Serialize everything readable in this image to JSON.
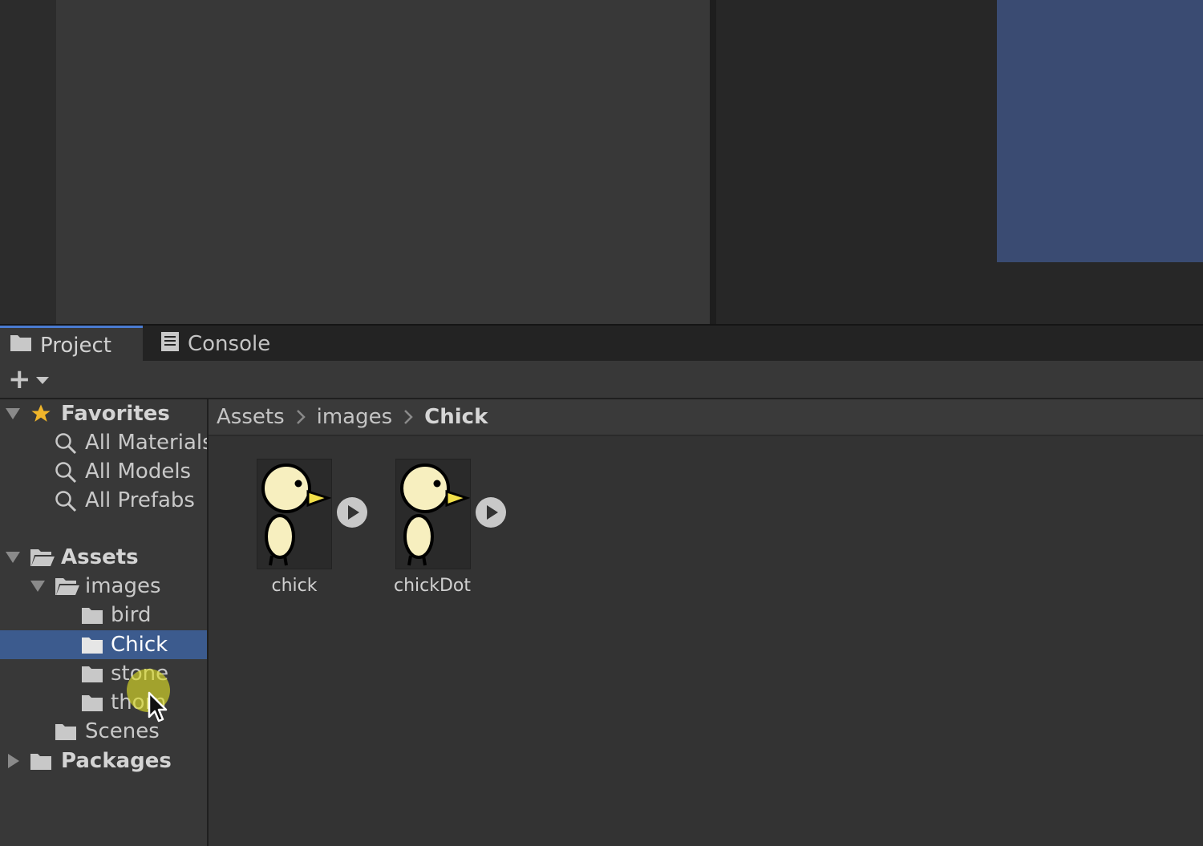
{
  "tabs": [
    {
      "label": "Project",
      "icon": "folder-icon",
      "active": true
    },
    {
      "label": "Console",
      "icon": "console-icon",
      "active": false
    }
  ],
  "toolbar": {
    "add_icon": "plus-icon",
    "dropdown_icon": "chevron-down-icon"
  },
  "sidebar": {
    "favorites": {
      "label": "Favorites",
      "items": [
        {
          "label": "All Materials"
        },
        {
          "label": "All Models"
        },
        {
          "label": "All Prefabs"
        }
      ]
    },
    "assets": {
      "label": "Assets",
      "images": {
        "label": "images",
        "children": [
          {
            "label": "bird"
          },
          {
            "label": "Chick",
            "selected": true
          },
          {
            "label": "stone"
          },
          {
            "label": "thorn"
          }
        ]
      },
      "scenes": {
        "label": "Scenes"
      }
    },
    "packages": {
      "label": "Packages"
    }
  },
  "breadcrumb": [
    {
      "label": "Assets"
    },
    {
      "label": "images"
    },
    {
      "label": "Chick",
      "current": true
    }
  ],
  "assets": [
    {
      "label": "chick"
    },
    {
      "label": "chickDot"
    }
  ],
  "colors": {
    "selection": "#3c5b8e",
    "active_tab_accent": "#4a7bd1",
    "game_preview": "#3a4b72",
    "star": "#f0b52a"
  }
}
